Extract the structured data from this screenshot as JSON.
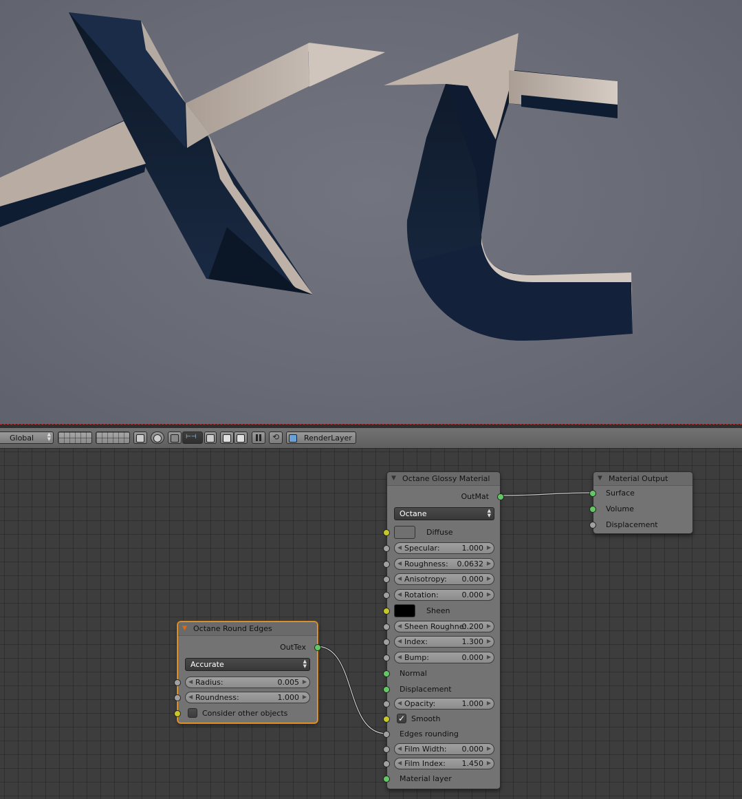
{
  "toolbar": {
    "pivot": "Global",
    "render_layer": "RenderLayer"
  },
  "nodes": {
    "round_edges": {
      "title": "Octane Round Edges",
      "output": "OutTex",
      "mode": "Accurate",
      "radius_label": "Radius:",
      "radius_value": "0.005",
      "roundness_label": "Roundness:",
      "roundness_value": "1.000",
      "consider_label": "Consider other objects"
    },
    "glossy": {
      "title": "Octane Glossy Material",
      "output": "OutMat",
      "engine": "Octane",
      "diffuse_label": "Diffuse",
      "diffuse_color": "#707070",
      "specular_label": "Specular:",
      "specular_value": "1.000",
      "roughness_label": "Roughness:",
      "roughness_value": "0.0632",
      "anisotropy_label": "Anisotropy:",
      "anisotropy_value": "0.000",
      "rotation_label": "Rotation:",
      "rotation_value": "0.000",
      "sheen_label": "Sheen",
      "sheen_color": "#000000",
      "sheen_rough_label": "Sheen Roughne:",
      "sheen_rough_value": "0.200",
      "index_label": "Index:",
      "index_value": "1.300",
      "bump_label": "Bump:",
      "bump_value": "0.000",
      "normal_label": "Normal",
      "displacement_label": "Displacement",
      "opacity_label": "Opacity:",
      "opacity_value": "1.000",
      "smooth_label": "Smooth",
      "smooth_checked": true,
      "edges_label": "Edges rounding",
      "film_width_label": "Film Width:",
      "film_width_value": "0.000",
      "film_index_label": "Film Index:",
      "film_index_value": "1.450",
      "material_layer_label": "Material layer"
    },
    "output": {
      "title": "Material Output",
      "surface_label": "Surface",
      "volume_label": "Volume",
      "displacement_label": "Displacement"
    }
  },
  "colors": {
    "socket_green": "#63c763",
    "socket_grey": "#a1a1a1",
    "socket_yellow": "#c7c729",
    "active_outline": "#f0a030"
  }
}
